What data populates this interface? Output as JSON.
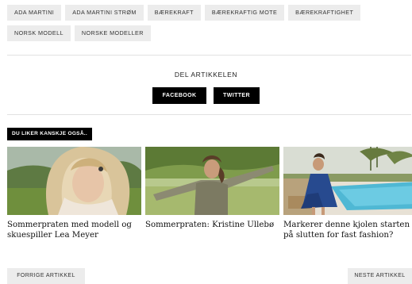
{
  "tags": [
    {
      "label": "ADA MARTINI"
    },
    {
      "label": "ADA MARTINI STRØM"
    },
    {
      "label": "BÆREKRAFT"
    },
    {
      "label": "BÆREKRAFTIG MOTE"
    },
    {
      "label": "BÆREKRAFTIGHET"
    },
    {
      "label": "NORSK MODELL"
    },
    {
      "label": "NORSKE MODELLER"
    }
  ],
  "share": {
    "title": "DEL ARTIKKELEN",
    "facebook_label": "FACEBOOK",
    "twitter_label": "TWITTER"
  },
  "related": {
    "label": "DU LIKER KANSKJE OGSÅ..",
    "articles": [
      {
        "title": "Sommerpraten med modell og skuespiller Lea Meyer",
        "image_icon": "photo-woman-blonde-hair"
      },
      {
        "title": "Sommerpraten: Kristine Ullebø",
        "image_icon": "photo-woman-arms-outstretched-field"
      },
      {
        "title": "Markerer denne kjolen starten på slutten for fast fashion?",
        "image_icon": "photo-woman-blue-dress-pool"
      }
    ]
  },
  "nav": {
    "prev_label": "FORRIGE ARTIKKEL",
    "next_label": "NESTE ARTIKKEL"
  },
  "colors": {
    "accent": "#000000",
    "tag_bg": "#ececec",
    "divider": "#e1e1e1"
  }
}
